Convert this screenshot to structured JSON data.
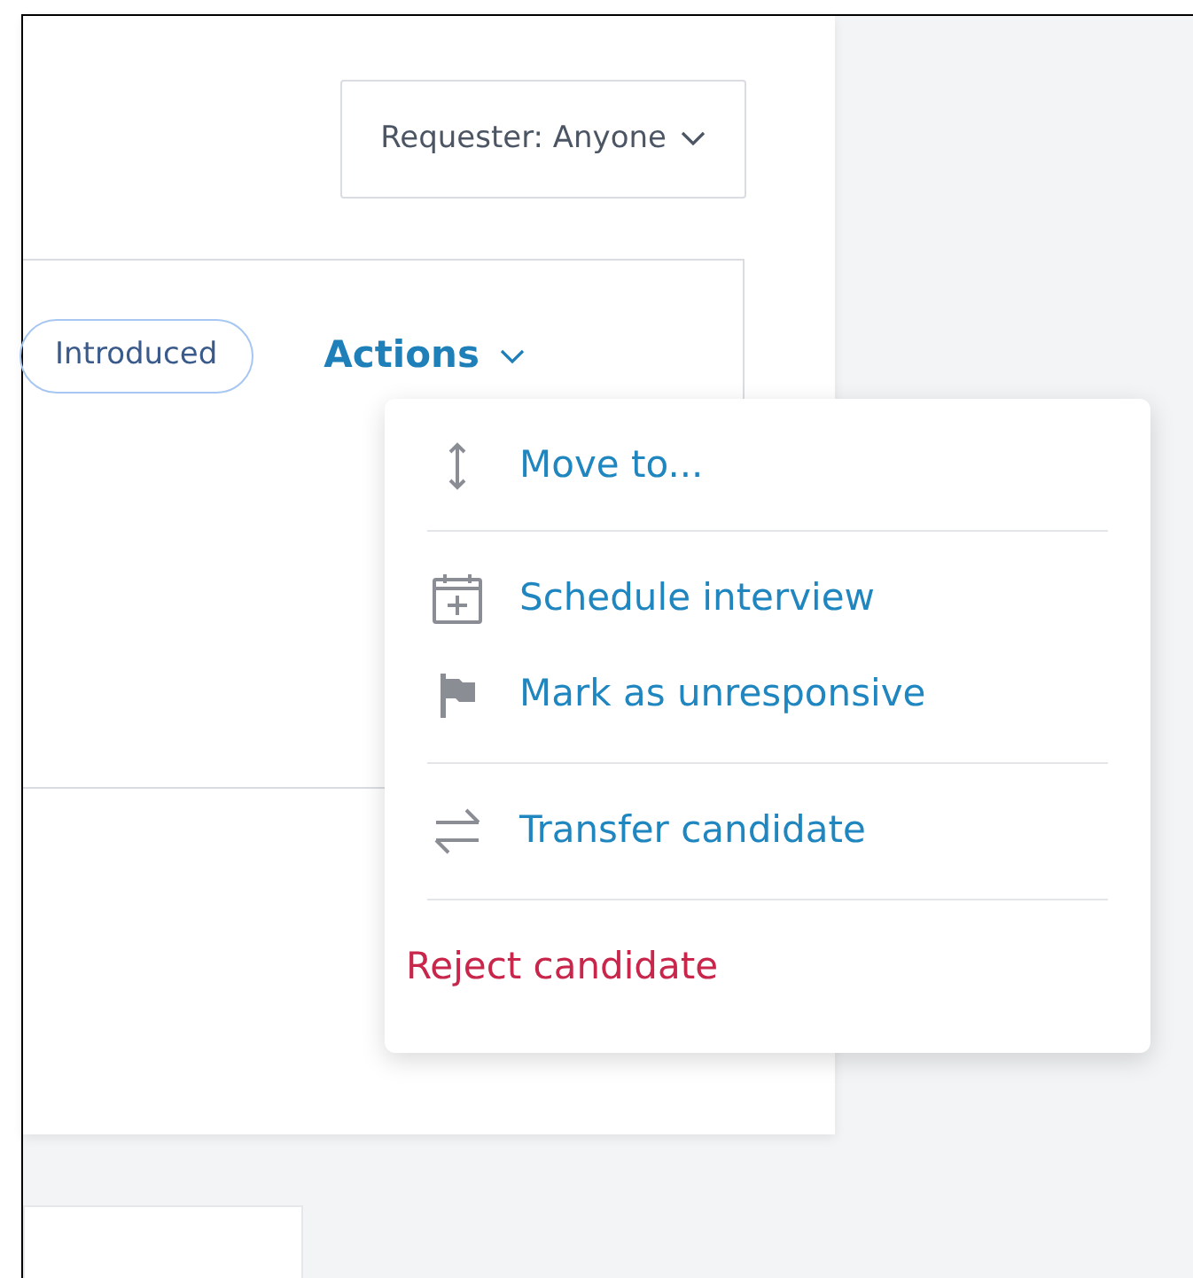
{
  "requester_filter": {
    "label": "Requester: Anyone"
  },
  "status_badge": "Introduced",
  "actions_button": {
    "label": "Actions",
    "expanded": true
  },
  "actions_menu": {
    "sections": [
      {
        "items": [
          {
            "kind": "move",
            "label": "Move to..."
          }
        ]
      },
      {
        "items": [
          {
            "kind": "schedule",
            "label": "Schedule interview"
          },
          {
            "kind": "flag",
            "label": "Mark as unresponsive"
          }
        ]
      },
      {
        "items": [
          {
            "kind": "transfer",
            "label": "Transfer candidate"
          }
        ]
      },
      {
        "items": [
          {
            "kind": "reject",
            "label": "Reject candidate"
          }
        ]
      }
    ]
  }
}
